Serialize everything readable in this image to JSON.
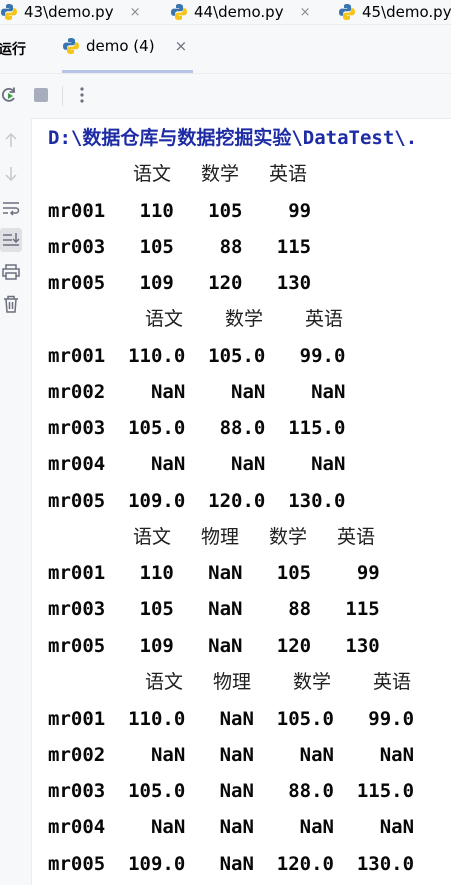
{
  "editor_tabs": [
    {
      "label": "43\\demo.py",
      "close": "×"
    },
    {
      "label": "44\\demo.py",
      "close": "×"
    },
    {
      "label": "45\\demo.py",
      "close": ""
    }
  ],
  "run_panel": {
    "title": "运行",
    "tab_label": "demo (4)",
    "tab_close": "×"
  },
  "console": {
    "path_line": "D:\\数据仓库与数据挖掘实验\\DataTest\\.",
    "blocks": [
      {
        "headers": [
          "语文",
          "数学",
          "英语"
        ],
        "rows": [
          "mr001   110   105    99",
          "mr003   105    88   115",
          "mr005   109   120   130"
        ]
      },
      {
        "headers": [
          "语文",
          "数学",
          "英语"
        ],
        "rows": [
          "mr001  110.0  105.0   99.0",
          "mr002    NaN    NaN    NaN",
          "mr003  105.0   88.0  115.0",
          "mr004    NaN    NaN    NaN",
          "mr005  109.0  120.0  130.0"
        ]
      },
      {
        "headers": [
          "语文",
          "物理",
          "数学",
          "英语"
        ],
        "rows": [
          "mr001   110   NaN   105    99",
          "mr003   105   NaN    88   115",
          "mr005   109   NaN   120   130"
        ]
      },
      {
        "headers": [
          "语文",
          "物理",
          "数学",
          "英语"
        ],
        "rows": [
          "mr001  110.0   NaN  105.0   99.0",
          "mr002    NaN   NaN    NaN    NaN",
          "mr003  105.0   NaN   88.0  115.0",
          "mr004    NaN   NaN    NaN    NaN",
          "mr005  109.0   NaN  120.0  130.0"
        ]
      }
    ]
  },
  "colors": {
    "path": "#1d2ca4",
    "accent": "#b6c4e6"
  }
}
